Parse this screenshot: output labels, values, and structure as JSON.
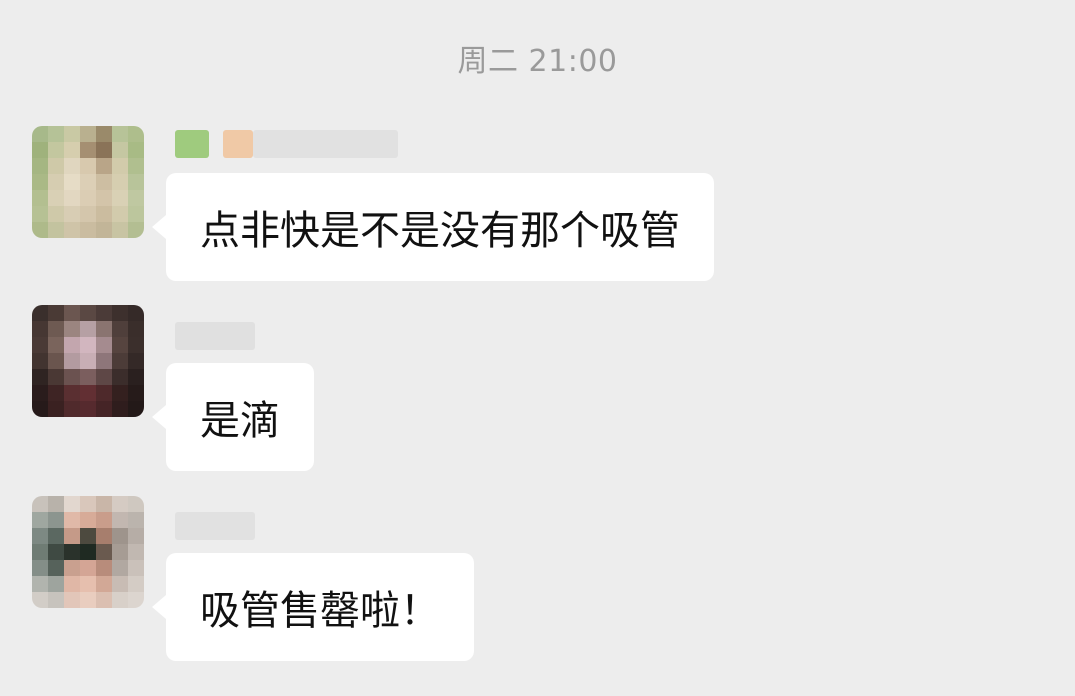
{
  "chat": {
    "timestamp": "周二 21:00",
    "messages": [
      {
        "sender": "",
        "text": "点非快是不是没有那个吸管",
        "avatar_icon": "user-avatar-pixelated"
      },
      {
        "sender": "",
        "text": "是滴",
        "avatar_icon": "user-avatar-pixelated"
      },
      {
        "sender": "",
        "text": "吸管售罄啦！",
        "avatar_icon": "user-avatar-pixelated"
      }
    ]
  },
  "colors": {
    "background": "#ededed",
    "bubble": "#ffffff",
    "text": "#111111",
    "timestamp": "#9a9a9a"
  }
}
